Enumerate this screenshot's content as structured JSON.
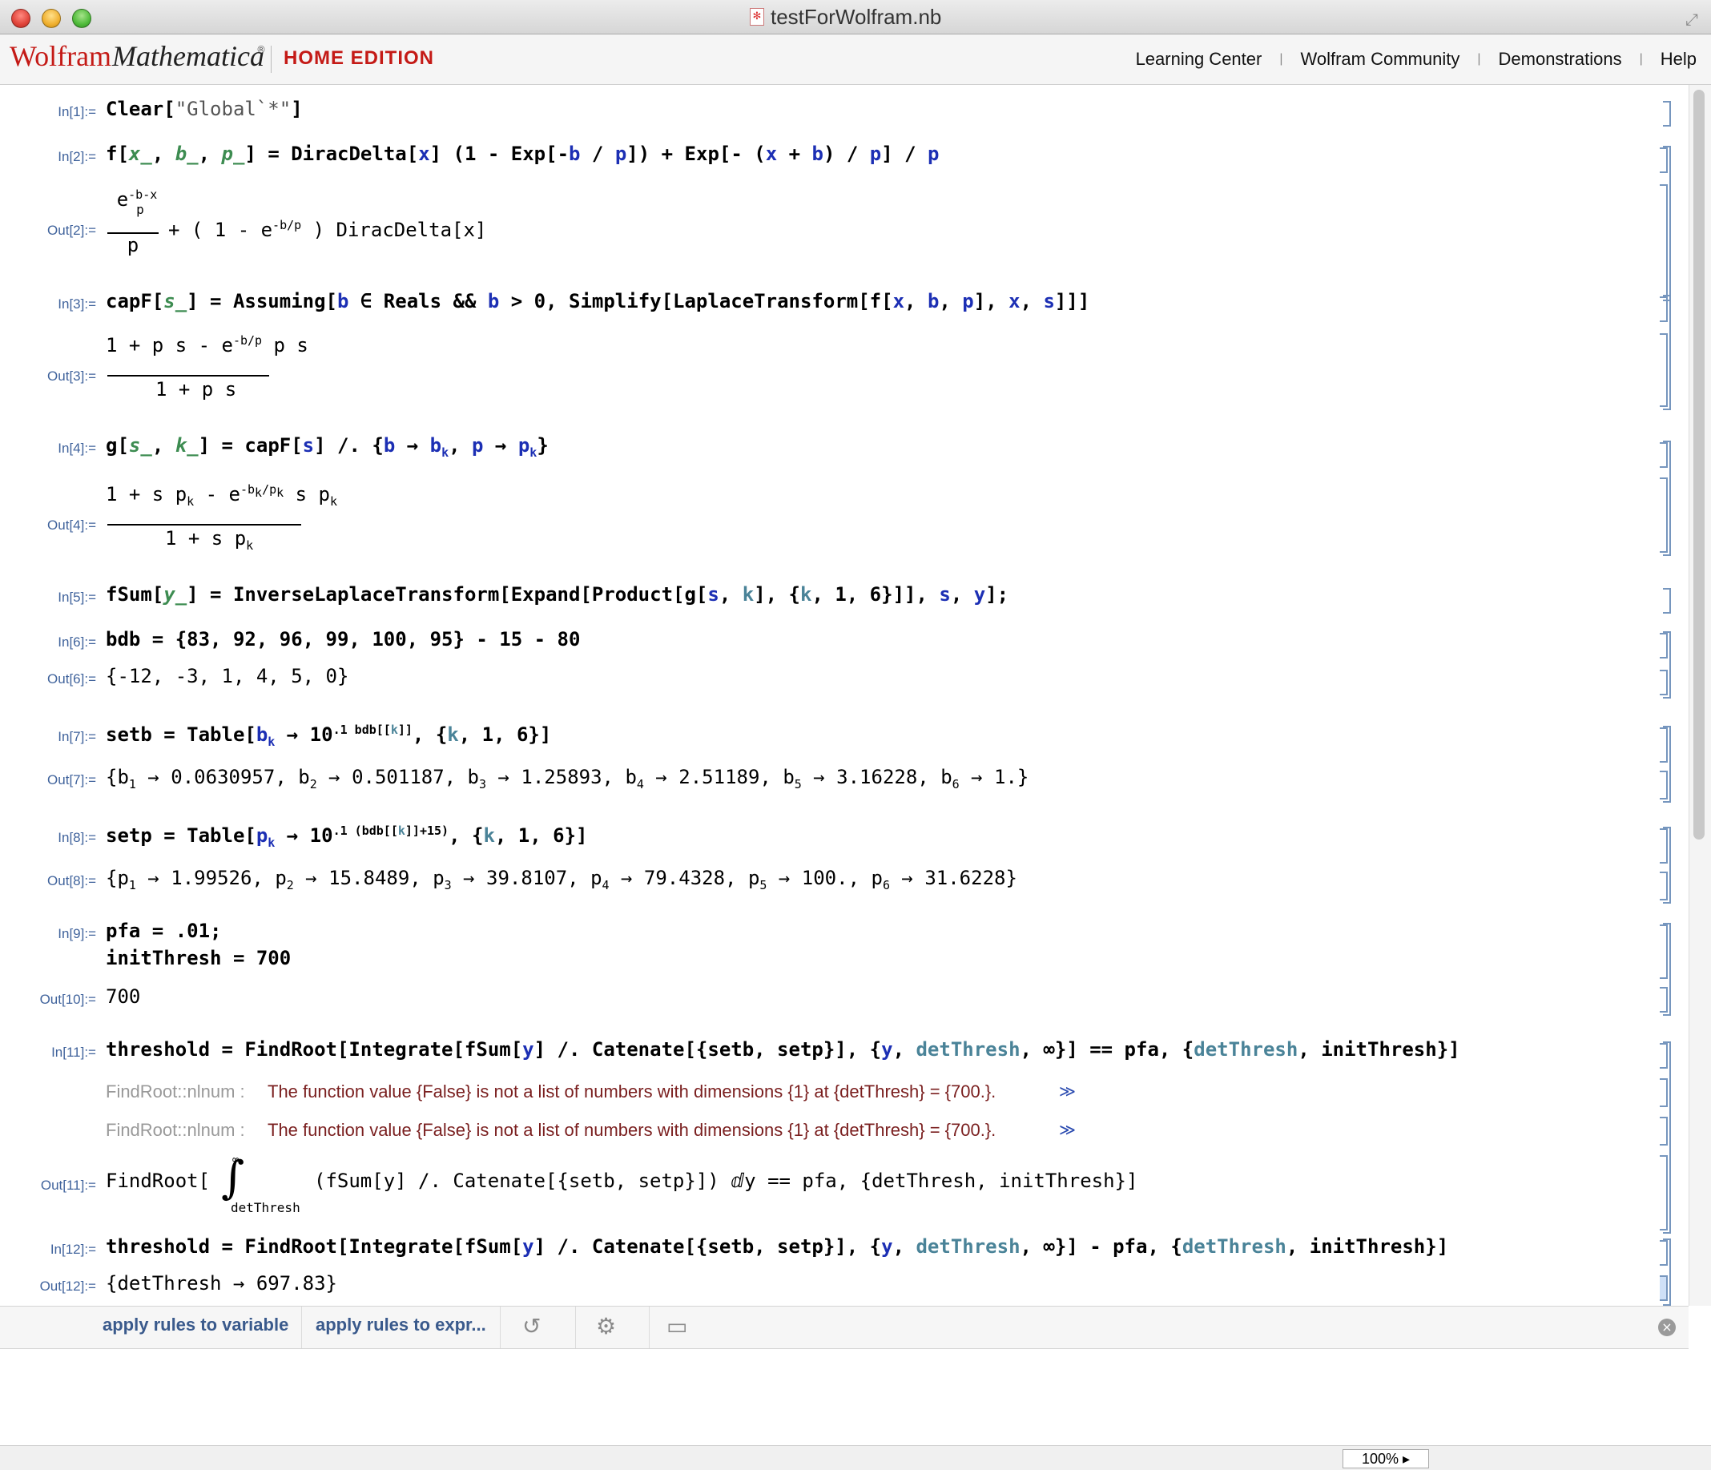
{
  "window": {
    "title": "testForWolfram.nb"
  },
  "brand": {
    "wolfram": "Wolfram",
    "mathematica": "Mathematica",
    "mark": "®",
    "edition": "HOME EDITION"
  },
  "toplinks": [
    "Learning Center",
    "Wolfram Community",
    "Demonstrations",
    "Help"
  ],
  "cells": {
    "in1": {
      "label": "In[1]:="
    },
    "in2": {
      "label": "In[2]:="
    },
    "out2": {
      "label": "Out[2]:="
    },
    "in3": {
      "label": "In[3]:="
    },
    "out3": {
      "label": "Out[3]:="
    },
    "in4": {
      "label": "In[4]:="
    },
    "out4": {
      "label": "Out[4]:="
    },
    "in5": {
      "label": "In[5]:="
    },
    "in6": {
      "label": "In[6]:="
    },
    "out6": {
      "label": "Out[6]:=",
      "text": "{-12, -3, 1, 4, 5, 0}"
    },
    "in7": {
      "label": "In[7]:="
    },
    "out7": {
      "label": "Out[7]:="
    },
    "in8": {
      "label": "In[8]:="
    },
    "out8": {
      "label": "Out[8]:="
    },
    "in9": {
      "label": "In[9]:=",
      "line1": "pfa = .01;",
      "line2": "initThresh = 700"
    },
    "out10": {
      "label": "Out[10]:=",
      "text": "700"
    },
    "in11": {
      "label": "In[11]:="
    },
    "msg": {
      "name": "FindRoot::nlnum :",
      "text": "The function value {False} is not a list of numbers with dimensions {1} at {detThresh} = {700.}.",
      "link": "≫"
    },
    "out11": {
      "label": "Out[11]:="
    },
    "in12": {
      "label": "In[12]:="
    },
    "out12": {
      "label": "Out[12]:=",
      "text": "{detThresh → 697.83}"
    }
  },
  "suggestions": {
    "item1": "apply rules to variable",
    "item2": "apply rules to expr..."
  },
  "status": {
    "zoom": "100%"
  }
}
